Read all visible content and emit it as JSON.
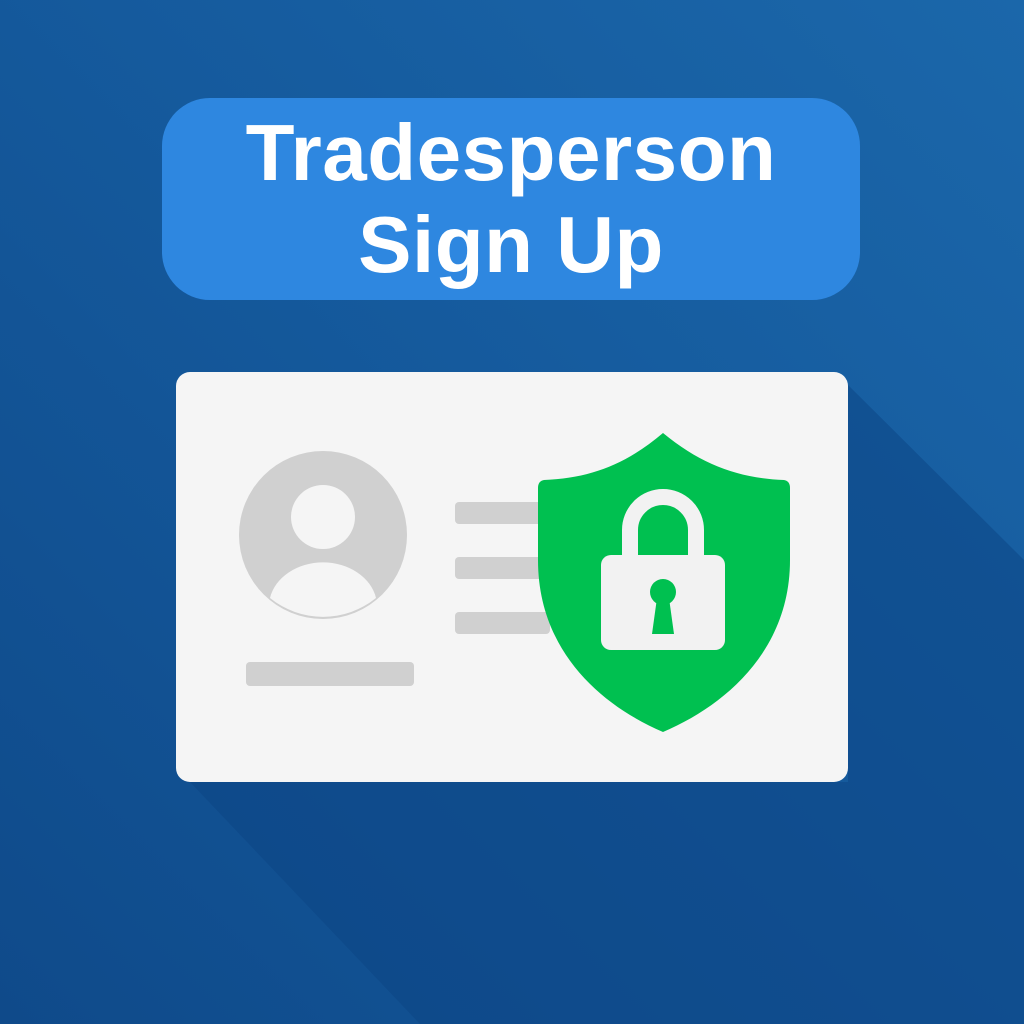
{
  "title": {
    "line1": "Tradesperson",
    "line2": "Sign Up"
  },
  "icons": [
    "user-avatar-icon",
    "shield-icon",
    "padlock-icon"
  ],
  "colors": {
    "background": "#155a9d",
    "title_pill": "#2e87e0",
    "card": "#f5f5f5",
    "placeholder": "#d0d0d0",
    "shield": "#00c050"
  }
}
